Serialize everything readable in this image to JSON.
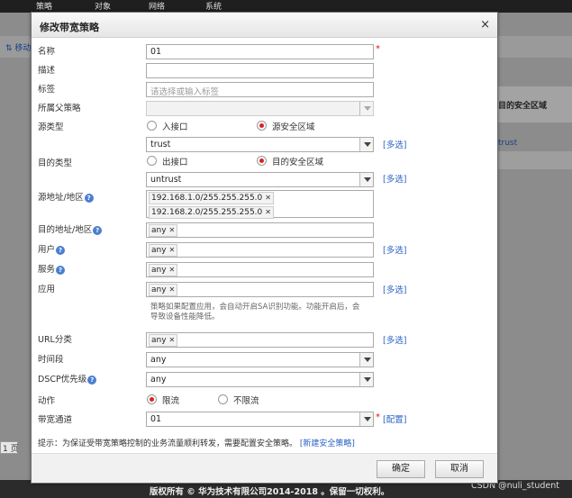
{
  "background": {
    "nav": [
      "策略",
      "对象",
      "网络",
      "系统"
    ],
    "toolbar_item": "移动",
    "table_header": "目的安全区域",
    "table_cell": "trust",
    "page_label": "1 页",
    "footer": "版权所有 © 华为技术有限公司2014-2018 。保留一切权利。",
    "watermark": "CSDN @nuli_student"
  },
  "dialog": {
    "title": "修改带宽策略",
    "close": "×",
    "name": {
      "label": "名称",
      "value": "01"
    },
    "description": {
      "label": "描述",
      "value": ""
    },
    "tag": {
      "label": "标签",
      "placeholder": "请选择或输入标签"
    },
    "parent_policy": {
      "label": "所属父策略",
      "value": ""
    },
    "source_type": {
      "label": "源类型",
      "options": [
        "入接口",
        "源安全区域"
      ],
      "selected": 1,
      "value": "trust",
      "multi": "[多选]"
    },
    "dest_type": {
      "label": "目的类型",
      "options": [
        "出接口",
        "目的安全区域"
      ],
      "selected": 1,
      "value": "untrust",
      "multi": "[多选]"
    },
    "source_address": {
      "label": "源地址/地区",
      "tags": [
        "192.168.1.0/255.255.255.0",
        "192.168.2.0/255.255.255.0"
      ]
    },
    "dest_address": {
      "label": "目的地址/地区",
      "tags": [
        "any"
      ]
    },
    "user": {
      "label": "用户",
      "tags": [
        "any"
      ],
      "multi": "[多选]"
    },
    "service": {
      "label": "服务",
      "tags": [
        "any"
      ]
    },
    "application": {
      "label": "应用",
      "tags": [
        "any"
      ],
      "multi": "[多选]",
      "note": "策略如果配置应用，会自动开启SA识别功能。功能开启后，会导致设备性能降低。"
    },
    "url_category": {
      "label": "URL分类",
      "tags": [
        "any"
      ],
      "multi": "[多选]"
    },
    "schedule": {
      "label": "时间段",
      "value": "any"
    },
    "dscp": {
      "label": "DSCP优先级",
      "value": "any"
    },
    "action": {
      "label": "动作",
      "options": [
        "限流",
        "不限流"
      ],
      "selected": 0
    },
    "channel": {
      "label": "带宽通道",
      "value": "01",
      "config": "[配置]"
    },
    "tip": {
      "text": "提示：为保证受带宽策略控制的业务流量顺利转发，需要配置安全策略。",
      "link": "[新建安全策略]"
    },
    "ok": "确定",
    "cancel": "取消"
  },
  "colors": {
    "accent_link": "#2a63c6",
    "radio_selected": "#d22222",
    "required": "#dd1111"
  }
}
